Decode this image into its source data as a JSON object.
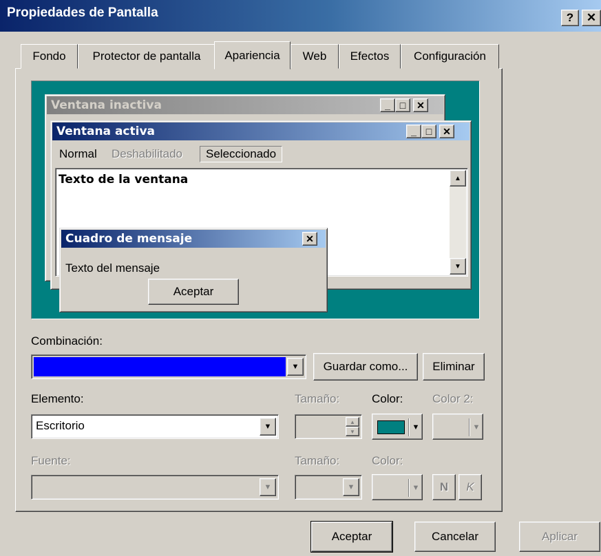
{
  "window": {
    "title": "Propiedades de Pantalla",
    "help_label": "?",
    "close_label": "✕"
  },
  "tabs": [
    {
      "label": "Fondo",
      "active": false
    },
    {
      "label": "Protector de pantalla",
      "active": false
    },
    {
      "label": "Apariencia",
      "active": true
    },
    {
      "label": "Web",
      "active": false
    },
    {
      "label": "Efectos",
      "active": false
    },
    {
      "label": "Configuración",
      "active": false
    }
  ],
  "preview": {
    "desktop_color": "#008080",
    "inactive_window_title": "Ventana inactiva",
    "active_window_title": "Ventana activa",
    "menu_items": [
      {
        "label": "Normal"
      },
      {
        "label": "Deshabilitado"
      },
      {
        "label": "Seleccionado"
      }
    ],
    "window_text": "Texto de la ventana",
    "message_box": {
      "title": "Cuadro de mensaje",
      "text": "Texto del mensaje",
      "ok_label": "Aceptar"
    },
    "caption_button_labels": {
      "minimize": "_",
      "maximize": "□",
      "close": "✕"
    }
  },
  "scheme": {
    "label": "Combinación:",
    "value_color": "#0000ff",
    "save_as_label": "Guardar como...",
    "delete_label": "Eliminar"
  },
  "element": {
    "label": "Elemento:",
    "value": "Escritorio",
    "size_label": "Tamaño:",
    "color_label": "Color:",
    "color_value": "#008080",
    "color2_label": "Color 2:"
  },
  "font": {
    "label": "Fuente:",
    "size_label": "Tamaño:",
    "color_label": "Color:",
    "bold_label": "N",
    "italic_label": "K"
  },
  "footer": {
    "ok_label": "Aceptar",
    "cancel_label": "Cancelar",
    "apply_label": "Aplicar"
  }
}
